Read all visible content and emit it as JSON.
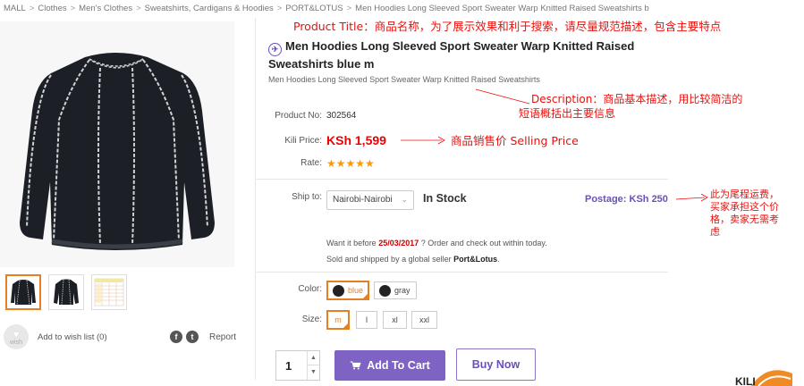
{
  "breadcrumb": [
    "MALL",
    "Clothes",
    "Men's Clothes",
    "Sweatshirts, Cardigans & Hoodies",
    "PORT&LOTUS",
    "Men Hoodies Long Sleeved Sport Sweater Warp Knitted Raised Sweatshirts b"
  ],
  "breadcrumb_separator": ">",
  "product": {
    "title": "Men Hoodies Long Sleeved Sport Sweater Warp Knitted Raised Sweatshirts blue m",
    "subtitle": "Men Hoodies Long Sleeved Sport Sweater Warp Knitted Raised Sweatshirts",
    "product_no_label": "Product No:",
    "product_no": "302564",
    "price_label": "Kili Price:",
    "price": "KSh 1,599",
    "rate_label": "Rate:",
    "rating": 5,
    "rating_stars": "★★★★★",
    "ship_label": "Ship to:",
    "ship_to": "Nairobi-Nairobi",
    "stock": "In Stock",
    "postage": "Postage: KSh 250",
    "want_before_prefix": "Want it before",
    "want_before_date": "25/03/2017",
    "want_before_suffix": "? Order and check out within today.",
    "sold_prefix": "Sold and shipped by a global seller",
    "seller": "Port&Lotus",
    "sold_suffix": ".",
    "color_label": "Color:",
    "colors": [
      "blue",
      "gray"
    ],
    "selected_color": "blue",
    "size_label": "Size:",
    "sizes": [
      "m",
      "l",
      "xl",
      "xxl"
    ],
    "selected_size": "m",
    "quantity": "1",
    "add_to_cart": "Add To Cart",
    "buy_now": "Buy Now"
  },
  "gallery": {
    "thumbnails": [
      "sweater-front",
      "sweater-angle",
      "size-chart"
    ],
    "active_index": 0
  },
  "wish": {
    "icon_text": "wish",
    "label": "Add to wish list (0)",
    "report": "Report"
  },
  "annotations": {
    "title_note": "Product Title：商品名称，为了展示效果和利于搜索，请尽量规范描述，包含主要特点",
    "desc_note_line1": "Description：商品基本描述，用比较简洁的",
    "desc_note_line2": "短语概括出主要信息",
    "price_note": "商品销售价 Selling Price",
    "postage_note_lines": [
      "此为尾程运费，",
      "买家承担这个价",
      "格，卖家无需考",
      "虑"
    ]
  },
  "colors": {
    "accent_purple": "#7e62c4",
    "price_red": "#e00000",
    "annotation_red": "#e8100c",
    "selection_orange": "#e67e22",
    "star_gold": "#f39c12"
  },
  "logo_text": "KILI"
}
